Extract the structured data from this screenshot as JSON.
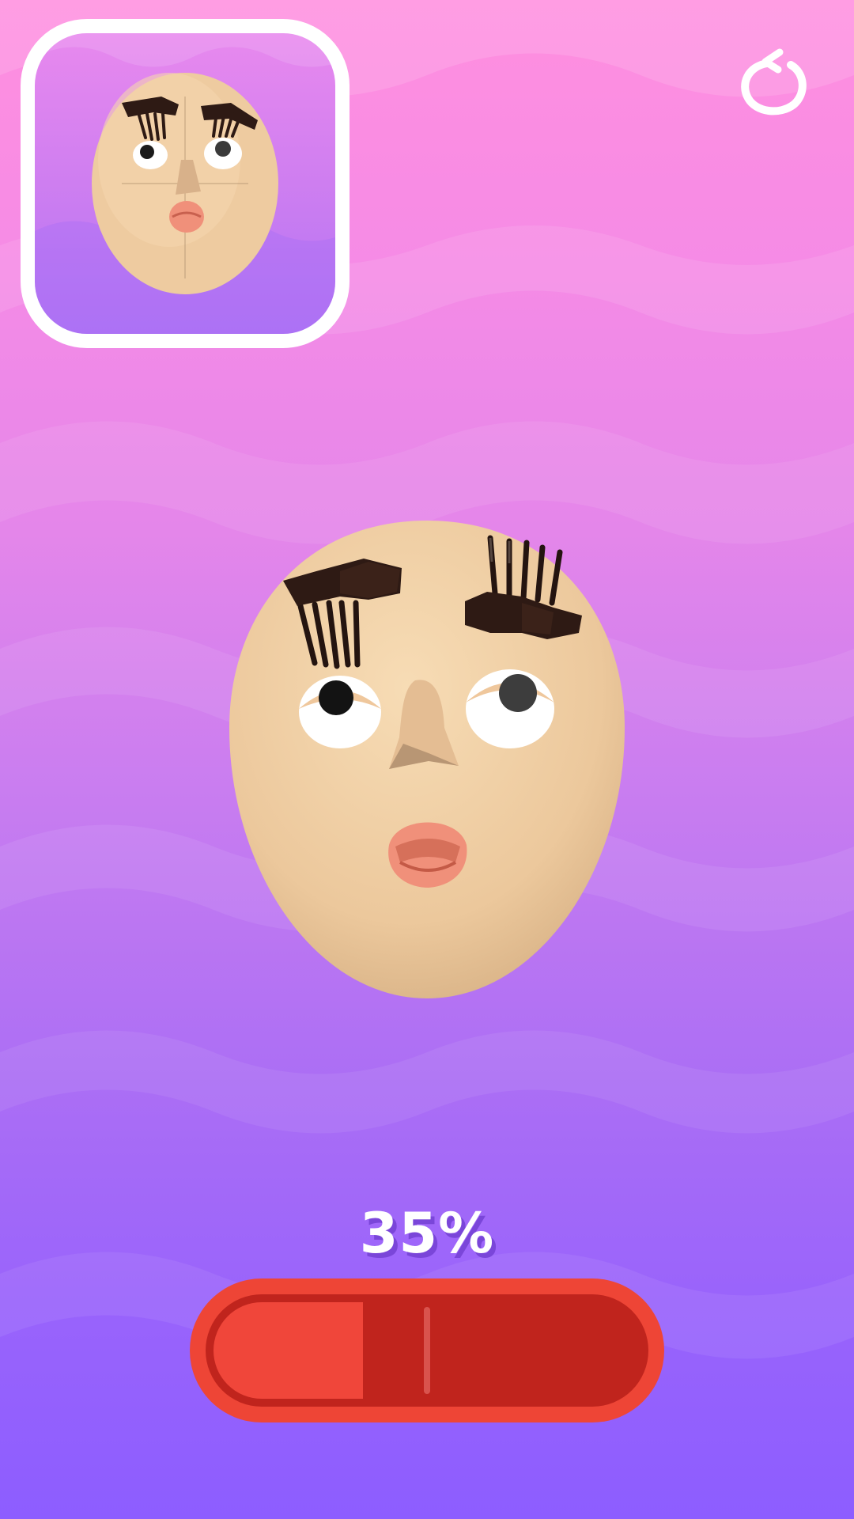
{
  "game": {
    "progress_text": "35%",
    "progress_value": 0.35,
    "target_marker": 0.5
  },
  "icons": {
    "restart": "restart-icon"
  },
  "colors": {
    "progress_fill": "#f0463a",
    "progress_track": "#c0241d",
    "progress_border": "#ee4536",
    "skin": "#f2d2a6",
    "brow": "#2e1a14",
    "lips": "#f0907a"
  }
}
